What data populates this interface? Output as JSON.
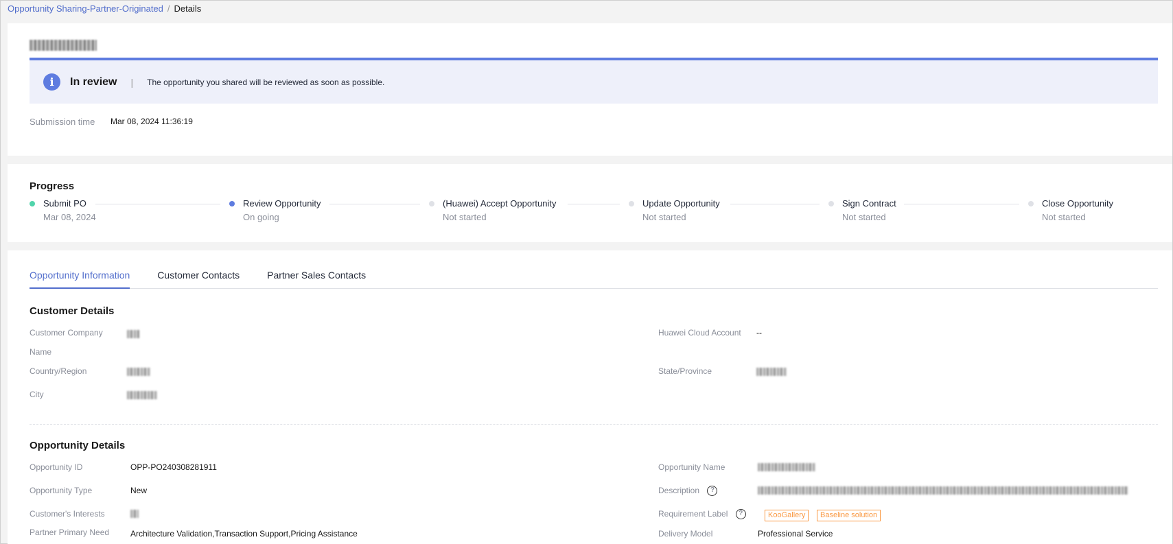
{
  "breadcrumb": {
    "parent": "Opportunity Sharing-Partner-Originated",
    "separator": "/",
    "current": "Details"
  },
  "status_banner": {
    "status": "In review",
    "separator": "|",
    "message": "The opportunity you shared will be reviewed as soon as possible.",
    "accent": "#5e7ce0"
  },
  "submission": {
    "label": "Submission time",
    "value": "Mar 08, 2024 11:36:19"
  },
  "progress": {
    "title": "Progress",
    "steps": [
      {
        "name": "Submit PO",
        "sub": "Mar 08, 2024",
        "color": "#50d4ab"
      },
      {
        "name": "Review Opportunity",
        "sub": "On going",
        "color": "#5e7ce0"
      },
      {
        "name": "(Huawei) Accept Opportunity",
        "sub": "Not started",
        "color": "#dfe1e6"
      },
      {
        "name": "Update Opportunity",
        "sub": "Not started",
        "color": "#dfe1e6"
      },
      {
        "name": "Sign Contract",
        "sub": "Not started",
        "color": "#dfe1e6"
      },
      {
        "name": "Close Opportunity",
        "sub": "Not started",
        "color": "#dfe1e6"
      }
    ]
  },
  "tabs": [
    {
      "label": "Opportunity Information"
    },
    {
      "label": "Customer Contacts"
    },
    {
      "label": "Partner Sales Contacts"
    }
  ],
  "customer_details": {
    "title": "Customer Details",
    "company_label_line1": "Customer Company",
    "company_label_line2": "Name",
    "cloud_account_label": "Huawei Cloud Account",
    "cloud_account_value": "--",
    "country_label": "Country/Region",
    "state_label": "State/Province",
    "city_label": "City"
  },
  "opportunity_details": {
    "title": "Opportunity Details",
    "id_label": "Opportunity ID",
    "id_value": "OPP-PO240308281911",
    "name_label": "Opportunity Name",
    "type_label": "Opportunity Type",
    "type_value": "New",
    "description_label": "Description",
    "interests_label": "Customer's Interests",
    "requirement_label": "Requirement Label",
    "requirement_tags": [
      "KooGallery",
      "Baseline solution"
    ],
    "primary_need_label": "Partner Primary Need",
    "primary_need_value": "Architecture Validation,Transaction Support,Pricing Assistance",
    "delivery_label": "Delivery Model",
    "delivery_value": "Professional Service"
  }
}
